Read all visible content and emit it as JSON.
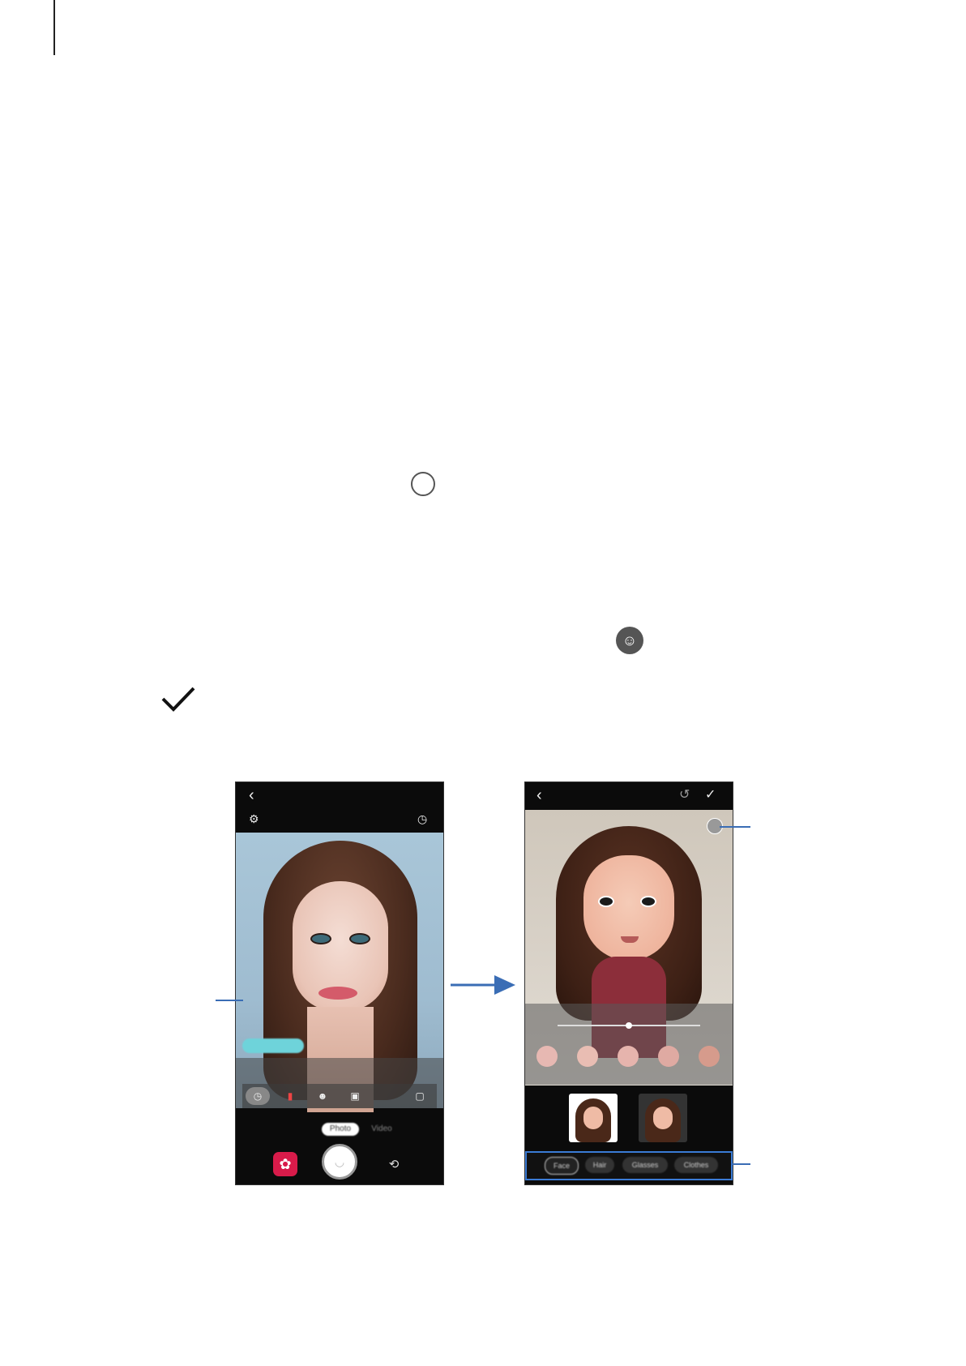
{
  "colors": {
    "accent": "#3a6db5",
    "gallery_button": "#d81b4a",
    "teal_pill": "#6ed3da"
  },
  "inline_icons": [
    "shutter-circle-icon",
    "emoji-avatar-edit-icon",
    "check-icon"
  ],
  "left_screen": {
    "icons": {
      "back": "‹",
      "settings": "⚙",
      "timer": "◷"
    },
    "prompt_text": "",
    "tray_icons": [
      "◷",
      "▮",
      "☻",
      "▣",
      "▢"
    ],
    "modes": [
      "Photo",
      "Video"
    ],
    "shutter_glyph": "◡",
    "switch_glyph": "⟲",
    "gallery_glyph": "✿"
  },
  "right_screen": {
    "icons": {
      "back": "‹",
      "reset": "↺",
      "done": "✓"
    },
    "slider_value": 0.5,
    "swatches": [
      "#e7b8b2",
      "#e9bdb3",
      "#e6b4ad",
      "#dfaaa2",
      "#d69b8c"
    ],
    "tabs": [
      "Face",
      "Hair",
      "Glasses",
      "Clothes"
    ]
  }
}
